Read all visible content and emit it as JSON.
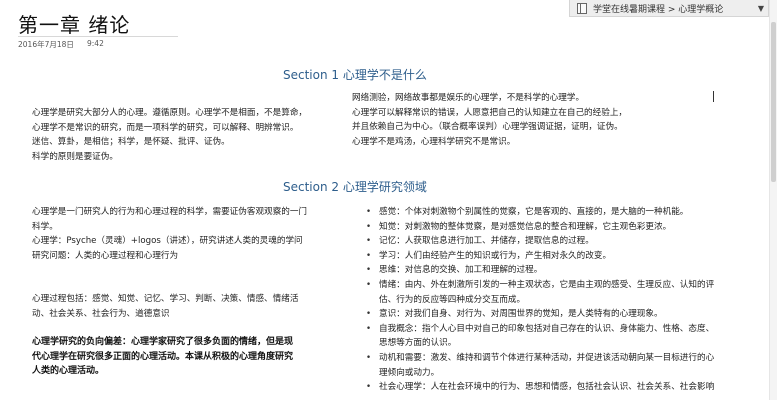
{
  "page": {
    "title": "第一章 绪论",
    "date": "2016年7月18日",
    "time": "9:42"
  },
  "breadcrumb": {
    "path": "学堂在线暑期课程 > 心理学概论",
    "icon": "notebook-icon"
  },
  "section1": {
    "heading": "Section 1 心理学不是什么",
    "left_lines": [
      "心理学是研究大部分人的心理。遵循原则。心理学不是相面，不是算命，",
      "心理学不是常识的研究，而是一项科学的研究，可以解释、明辨常识。",
      "迷信、算卦，是相信；科学，是怀疑、批评、证伪。",
      "科学的原则是要证伪。"
    ],
    "right_lines": [
      "网络测验，网络故事都是娱乐的心理学，不是科学的心理学。",
      "心理学可以解释常识的错误，人愿意把自己的认知建立在自己的经验上，",
      "并且依赖自己为中心。（联合概率误判）心理学强调证据，证明，证伪。",
      "心理学不是鸡汤，心理科学研究不是常识。"
    ]
  },
  "section2": {
    "heading": "Section 2 心理学研究领域",
    "left_lines": [
      "心理学是一门研究人的行为和心理过程的科学，需要证伪客观观察的一门",
      "科学。",
      "心理学：Psyche（灵魂）+logos（讲述），研究讲述人类的灵魂的学问",
      "研究问题：人类的心理过程和心理行为"
    ],
    "process_lines": [
      "心理过程包括：感觉、知觉、记忆、学习、判断、决策、情感、情绪活",
      "动、社会关系、社会行为、道德意识"
    ],
    "bold_lines": [
      "心理学研究的负向偏差：心理学家研究了很多负面的情绪，但是现",
      "代心理学在研究很多正面的心理活动。本课从积极的心理角度研究",
      "人类的心理活动。"
    ],
    "bullets": [
      [
        "感觉：个体对刺激物个别属性的觉察，它是客观的、直接的，是大脑的一种机能。"
      ],
      [
        "知觉：对刺激物的整体觉察，是对感觉信息的整合和理解，它主观色彩更浓。"
      ],
      [
        "记忆：人获取信息进行加工、并储存，提取信息的过程。"
      ],
      [
        "学习：人们由经验产生的知识或行为，产生相对永久的改变。"
      ],
      [
        "思维：对信息的交换、加工和理解的过程。"
      ],
      [
        "情绪：由内、外在刺激所引发的一种主观状态，它是由主观的感受、生理反应、认知的评",
        "估、行为的反应等四种成分交互而成。"
      ],
      [
        "意识：对我们自身、对行为、对周围世界的觉知，是人类特有的心理现象。"
      ],
      [
        "自我概念：指个人心目中对自己的印象包括对自己存在的认识、身体能力、性格、态度、",
        "思想等方面的认识。"
      ],
      [
        "动机和需要：激发、维持和调节个体进行某种活动，并促进该活动朝向某一目标进行的心",
        "理倾向或动力。"
      ],
      [
        "社会心理学：人在社会环境中的行为、思想和情感，包括社会认识、社会关系、社会影响"
      ]
    ]
  }
}
